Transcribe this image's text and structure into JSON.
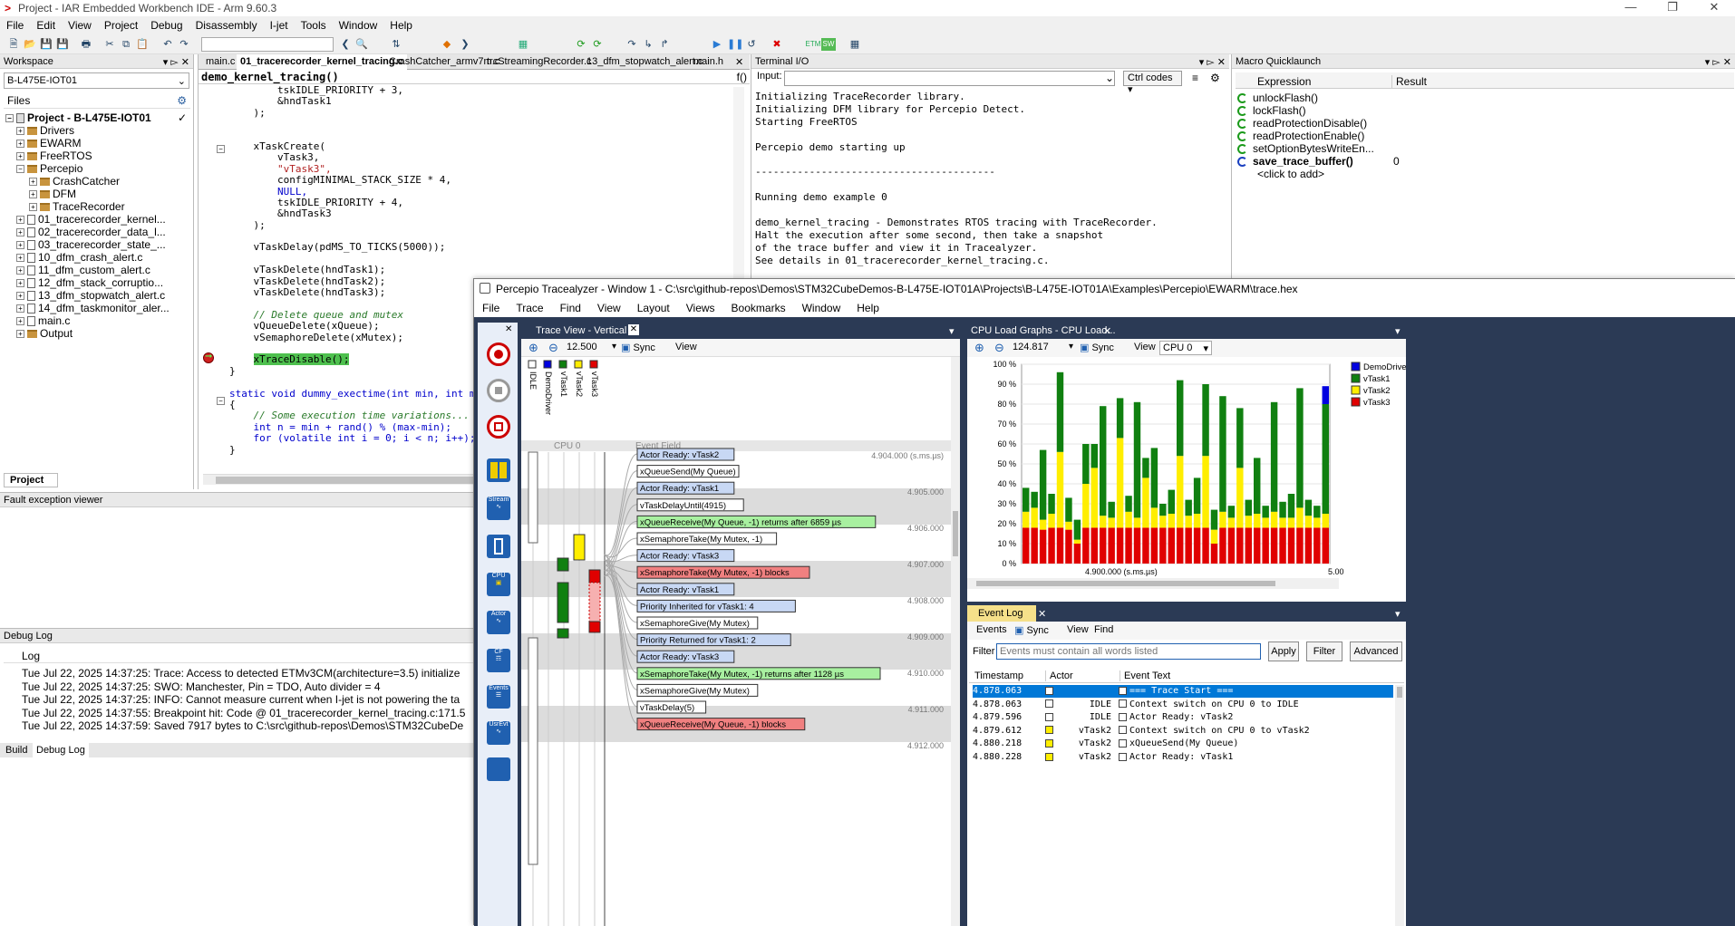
{
  "app": {
    "title": "Project - IAR Embedded Workbench IDE - Arm 9.60.3"
  },
  "menu": [
    "File",
    "Edit",
    "View",
    "Project",
    "Debug",
    "Disassembly",
    "I-jet",
    "Tools",
    "Window",
    "Help"
  ],
  "workspace": {
    "header": "Workspace",
    "config": "B-L475E-IOT01",
    "files_label": "Files",
    "project": "Project - B-L475E-IOT01",
    "items": [
      "Drivers",
      "EWARM",
      "FreeRTOS",
      "Percepio",
      "CrashCatcher",
      "DFM",
      "TraceRecorder",
      "01_tracerecorder_kernel...",
      "02_tracerecorder_data_l...",
      "03_tracerecorder_state_...",
      "10_dfm_crash_alert.c",
      "11_dfm_custom_alert.c",
      "12_dfm_stack_corruptio...",
      "13_dfm_stopwatch_alert.c",
      "14_dfm_taskmonitor_aler...",
      "main.c",
      "Output"
    ],
    "tab": "Project"
  },
  "editor": {
    "tabs": [
      "main.c",
      "01_tracerecorder_kernel_tracing.c",
      "CrashCatcher_armv7m.c",
      "trcStreamingRecorder.c",
      "13_dfm_stopwatch_alert.c",
      "main.h"
    ],
    "function": "demo_kernel_tracing()",
    "lines": [
      "        tskIDLE_PRIORITY + 3,",
      "        &hndTask1",
      "    );",
      "",
      "",
      "    xTaskCreate(",
      "        vTask3,",
      "        \"vTask3\",",
      "        configMINIMAL_STACK_SIZE * 4,",
      "        NULL,",
      "        tskIDLE_PRIORITY + 4,",
      "        &hndTask3",
      "    );",
      "",
      "    vTaskDelay(pdMS_TO_TICKS(5000));",
      "",
      "    vTaskDelete(hndTask1);",
      "    vTaskDelete(hndTask2);",
      "    vTaskDelete(hndTask3);",
      "",
      "    // Delete queue and mutex",
      "    vQueueDelete(xQueue);",
      "    vSemaphoreDelete(xMutex);",
      "",
      "    xTraceDisable();",
      "}",
      "",
      "static void dummy_exectime(int min, int max)",
      "{",
      "    // Some execution time variations...",
      "    int n = min + rand() % (max-min);",
      "    for (volatile int i = 0; i < n; i++);",
      "}"
    ]
  },
  "terminal": {
    "header": "Terminal I/O",
    "input_label": "Input:",
    "ctrl_codes": "Ctrl codes",
    "output": [
      "Initializing TraceRecorder library.",
      "Initializing DFM library for Percepio Detect.",
      "Starting FreeRTOS",
      "",
      "Percepio demo starting up",
      "",
      "----------------------------------------",
      "",
      "Running demo example 0",
      "",
      "demo_kernel_tracing - Demonstrates RTOS tracing with TraceRecorder.",
      "Halt the execution after some second, then take a snapshot",
      "of the trace buffer and view it in Tracealyzer.",
      "See details in 01_tracerecorder_kernel_tracing.c."
    ]
  },
  "macro": {
    "header": "Macro Quicklaunch",
    "col_expression": "Expression",
    "col_result": "Result",
    "items": [
      "unlockFlash()",
      "lockFlash()",
      "readProtectionDisable()",
      "readProtectionEnable()",
      "setOptionBytesWriteEn...",
      "save_trace_buffer()"
    ],
    "active_result": "0",
    "add": "<click to add>"
  },
  "fault": {
    "header": "Fault exception viewer"
  },
  "debuglog": {
    "header": "Debug Log",
    "col": "Log",
    "lines": [
      "Tue Jul 22, 2025 14:37:25: Trace: Access to detected ETMv3CM(architecture=3.5) initialize",
      "Tue Jul 22, 2025 14:37:25: SWO: Manchester, Pin = TDO, Auto divider = 4",
      "Tue Jul 22, 2025 14:37:25: INFO: Cannot measure current when I-jet is not powering the ta",
      "Tue Jul 22, 2025 14:37:55: Breakpoint hit: Code @ 01_tracerecorder_kernel_tracing.c:171.5",
      "Tue Jul 22, 2025 14:37:59: Saved 7917 bytes to C:\\src\\github-repos\\Demos\\STM32CubeDe"
    ],
    "tabs": [
      "Build",
      "Debug Log"
    ]
  },
  "tracealyzer": {
    "title": "Percepio Tracealyzer - Window 1 - C:\\src\\github-repos\\Demos\\STM32CubeDemos-B-L475E-IOT01A\\Projects\\B-L475E-IOT01A\\Examples\\Percepio\\EWARM\\trace.hex",
    "menu": [
      "File",
      "Trace",
      "Find",
      "View",
      "Layout",
      "Views",
      "Bookmarks",
      "Window",
      "Help"
    ],
    "left_labels": [
      "Stream",
      "CPU",
      "Actor",
      "CF",
      "Events",
      "UsrEvt"
    ],
    "trace_view": {
      "tab": "Trace View - Vertical",
      "zoom": "12.500",
      "sync": "Sync",
      "view": "View",
      "actors": [
        "IDLE",
        "DemoDriver",
        "vTask1",
        "vTask2",
        "vTask3"
      ],
      "cpu_label": "CPU 0",
      "event_field": "Event Field",
      "ticks": [
        "4.904.000 (s.ms.µs)",
        "4.905.000",
        "4.906.000",
        "4.907.000",
        "4.908.000",
        "4.909.000",
        "4.910.000",
        "4.911.000",
        "4.912.000"
      ],
      "events": [
        {
          "text": "Actor Ready: vTask2",
          "kind": "blue"
        },
        {
          "text": "xQueueSend(My Queue)",
          "kind": "white"
        },
        {
          "text": "Actor Ready: vTask1",
          "kind": "blue"
        },
        {
          "text": "vTaskDelayUntil(4915)",
          "kind": "white"
        },
        {
          "text": "xQueueReceive(My Queue, -1) returns after 6859 µs",
          "kind": "green"
        },
        {
          "text": "xSemaphoreTake(My Mutex, -1)",
          "kind": "white"
        },
        {
          "text": "Actor Ready: vTask3",
          "kind": "blue"
        },
        {
          "text": "xSemaphoreTake(My Mutex, -1) blocks",
          "kind": "red"
        },
        {
          "text": "Actor Ready: vTask1",
          "kind": "blue"
        },
        {
          "text": "Priority Inherited for vTask1: 4",
          "kind": "blue"
        },
        {
          "text": "xSemaphoreGive(My Mutex)",
          "kind": "white"
        },
        {
          "text": "Priority Returned for vTask1: 2",
          "kind": "blue"
        },
        {
          "text": "Actor Ready: vTask3",
          "kind": "blue"
        },
        {
          "text": "xSemaphoreTake(My Mutex, -1) returns after 1128 µs",
          "kind": "green"
        },
        {
          "text": "xSemaphoreGive(My Mutex)",
          "kind": "white"
        },
        {
          "text": "vTaskDelay(5)",
          "kind": "white"
        },
        {
          "text": "xQueueReceive(My Queue, -1) blocks",
          "kind": "red"
        }
      ]
    },
    "cpu_graph": {
      "tab": "CPU Load Graphs - CPU Load...",
      "zoom": "124.817",
      "sync": "Sync",
      "view": "View",
      "cpu": "CPU 0",
      "legend": [
        "DemoDriver",
        "vTask1",
        "vTask2",
        "vTask3"
      ],
      "xlabel": "4.900.000 (s.ms.µs)",
      "xlabel_right": "5.00"
    },
    "event_log": {
      "tab": "Event Log",
      "toolbar": [
        "Events",
        "Sync",
        "View",
        "Find"
      ],
      "filter_label": "Filter",
      "filter_placeholder": "Events must contain all words listed",
      "apply": "Apply",
      "filter_btn": "Filter",
      "advanced": "Advanced",
      "columns": [
        "Timestamp",
        "Actor",
        "Event Text"
      ],
      "rows": [
        {
          "ts": "4.878.063",
          "actor": "",
          "text": "=== Trace Start ===",
          "color": "#ffffff",
          "sel": true
        },
        {
          "ts": "4.878.063",
          "actor": "IDLE",
          "text": "Context switch on CPU 0 to IDLE",
          "color": "#ffffff"
        },
        {
          "ts": "4.879.596",
          "actor": "IDLE",
          "text": "Actor Ready: vTask2",
          "color": "#ffffff"
        },
        {
          "ts": "4.879.612",
          "actor": "vTask2",
          "text": "Context switch on CPU 0 to vTask2",
          "color": "#ffee00"
        },
        {
          "ts": "4.880.218",
          "actor": "vTask2",
          "text": "xQueueSend(My Queue)",
          "color": "#ffee00"
        },
        {
          "ts": "4.880.228",
          "actor": "vTask2",
          "text": "Actor Ready: vTask1",
          "color": "#ffee00"
        }
      ]
    }
  },
  "chart_data": {
    "type": "bar",
    "title": "",
    "ylim": [
      0,
      100
    ],
    "yticks": [
      "100 %",
      "90 %",
      "80 %",
      "70 %",
      "60 %",
      "50 %",
      "40 %",
      "30 %",
      "20 %",
      "10 %",
      "0 %"
    ],
    "series": [
      {
        "name": "vTask3",
        "values": [
          18,
          18,
          17,
          18,
          18,
          17,
          10,
          18,
          18,
          18,
          18,
          18,
          18,
          18,
          18,
          18,
          18,
          18,
          18,
          18,
          18,
          18,
          10,
          18,
          18,
          18,
          18,
          18,
          18,
          18,
          18,
          18,
          18,
          18,
          18,
          18
        ]
      },
      {
        "name": "vTask2",
        "values": [
          8,
          10,
          5,
          7,
          38,
          4,
          2,
          22,
          30,
          6,
          5,
          45,
          8,
          5,
          25,
          10,
          6,
          7,
          36,
          6,
          7,
          36,
          7,
          8,
          5,
          30,
          6,
          7,
          5,
          8,
          5,
          5,
          10,
          6,
          5,
          7
        ]
      },
      {
        "name": "vTask1",
        "values": [
          12,
          8,
          35,
          10,
          40,
          12,
          10,
          20,
          12,
          55,
          8,
          20,
          8,
          58,
          10,
          30,
          6,
          12,
          38,
          8,
          18,
          36,
          10,
          58,
          6,
          30,
          8,
          28,
          6,
          55,
          8,
          12,
          60,
          8,
          6,
          55
        ]
      },
      {
        "name": "DemoDriver",
        "values": [
          0,
          0,
          0,
          0,
          0,
          0,
          0,
          0,
          0,
          0,
          0,
          0,
          0,
          0,
          0,
          0,
          0,
          0,
          0,
          0,
          0,
          0,
          0,
          0,
          0,
          0,
          0,
          0,
          0,
          0,
          0,
          0,
          0,
          0,
          0,
          9
        ]
      }
    ],
    "colors": {
      "vTask3": "#e00000",
      "vTask2": "#ffee00",
      "vTask1": "#108010",
      "DemoDriver": "#0000e0"
    }
  }
}
